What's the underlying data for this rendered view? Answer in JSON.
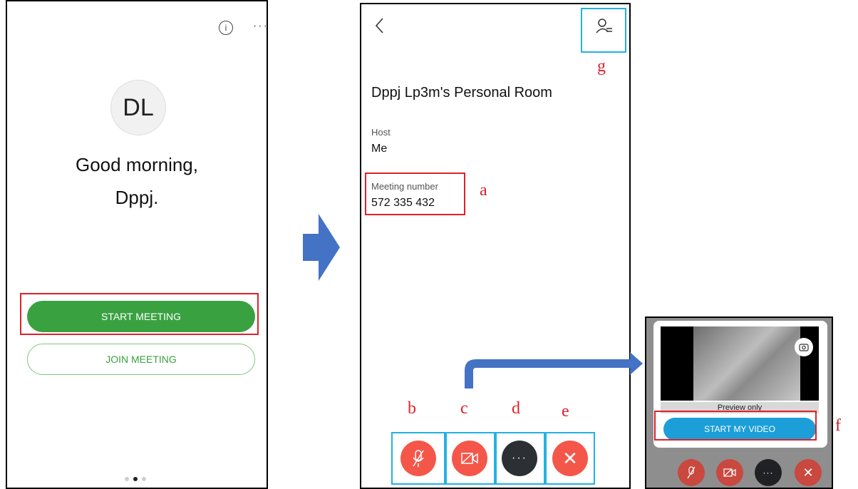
{
  "screen1": {
    "info_icon": "info-icon",
    "more_icon": "more-dots-icon",
    "more_text": "···",
    "avatar_initials": "DL",
    "greeting_line1": "Good morning,",
    "greeting_line2": "Dppj.",
    "start_meeting": "START MEETING",
    "join_meeting": "JOIN MEETING",
    "page_dots": 3,
    "active_dot": 1
  },
  "screen2": {
    "back_icon": "chevron-left-icon",
    "participants_icon": "participants-icon",
    "room_title": "Dppj Lp3m's Personal Room",
    "host_label": "Host",
    "host_value": "Me",
    "meeting_number_label": "Meeting number",
    "meeting_number": "572 335 432",
    "controls": [
      {
        "name": "mute",
        "icon": "mic-off-icon"
      },
      {
        "name": "video",
        "icon": "video-off-icon"
      },
      {
        "name": "more",
        "icon": "more-dots-icon",
        "text": "···"
      },
      {
        "name": "leave",
        "icon": "close-icon",
        "text": "✕"
      }
    ]
  },
  "screen3": {
    "preview_label": "Preview only",
    "start_video": "START MY VIDEO",
    "camera_switch_icon": "camera-switch-icon"
  },
  "annotations": {
    "a": "a",
    "b": "b",
    "c": "c",
    "d": "d",
    "e": "e",
    "f": "f",
    "g": "g"
  },
  "colors": {
    "green": "#3aa141",
    "red_control": "#f4574a",
    "dark_control": "#2c2f33",
    "blue_pill": "#1c9fd8",
    "annotation_red": "#e0202a",
    "annotation_blue": "#22b2e2",
    "arrow_blue": "#4472c4"
  }
}
